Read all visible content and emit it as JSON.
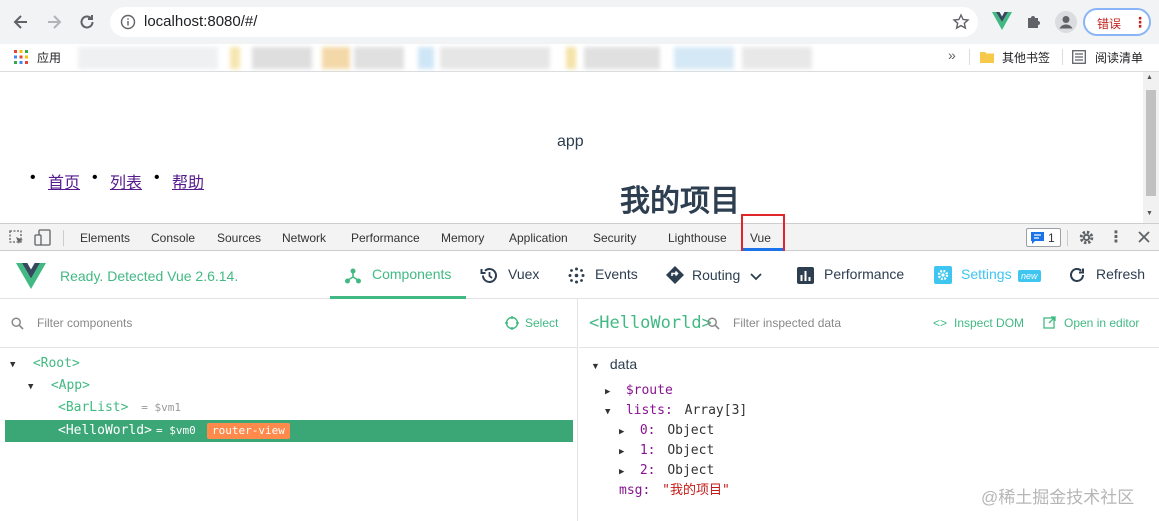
{
  "browser": {
    "url": "localhost:8080/#/",
    "error_label": "错误",
    "bookmarks": {
      "apps_label": "应用",
      "more": "»",
      "other_label": "其他书签",
      "reading_label": "阅读清单"
    }
  },
  "page": {
    "app_text": "app",
    "nav": [
      "首页",
      "列表",
      "帮助"
    ],
    "heading": "我的项目"
  },
  "devtools": {
    "tabs": [
      "Elements",
      "Console",
      "Sources",
      "Network",
      "Performance",
      "Memory",
      "Application",
      "Security",
      "Lighthouse",
      "Vue"
    ],
    "active_tab": "Vue",
    "message_count": "1"
  },
  "vue": {
    "status": "Ready. Detected Vue 2.6.14.",
    "toolbar": {
      "components": "Components",
      "vuex": "Vuex",
      "events": "Events",
      "routing": "Routing",
      "performance": "Performance",
      "settings": "Settings",
      "settings_badge": "new",
      "refresh": "Refresh"
    },
    "left": {
      "filter_placeholder": "Filter components",
      "select_label": "Select",
      "tree": {
        "root": "<Root>",
        "app": "<App>",
        "barlist": "<BarList>",
        "barlist_ref": "= $vm1",
        "helloworld": "<HelloWorld>",
        "helloworld_ref": "= $vm0",
        "helloworld_badge": "router-view"
      }
    },
    "right": {
      "component_name": "<HelloWorld>",
      "filter_placeholder": "Filter inspected data",
      "inspect_dom": "Inspect DOM",
      "open_editor": "Open in editor",
      "section": "data",
      "route_key": "$route",
      "lists_key": "lists:",
      "lists_val": "Array[3]",
      "items": [
        {
          "key": "0:",
          "val": "Object"
        },
        {
          "key": "1:",
          "val": "Object"
        },
        {
          "key": "2:",
          "val": "Object"
        }
      ],
      "msg_key": "msg:",
      "msg_val": "\"我的项目\""
    }
  },
  "watermark": "@稀土掘金技术社区",
  "colors": {
    "vue_green": "#42b983",
    "selected_row": "#3ba776",
    "badge_orange": "#ff8a4c",
    "highlight_red": "#e0262b",
    "link_purple": "#551a8b"
  }
}
